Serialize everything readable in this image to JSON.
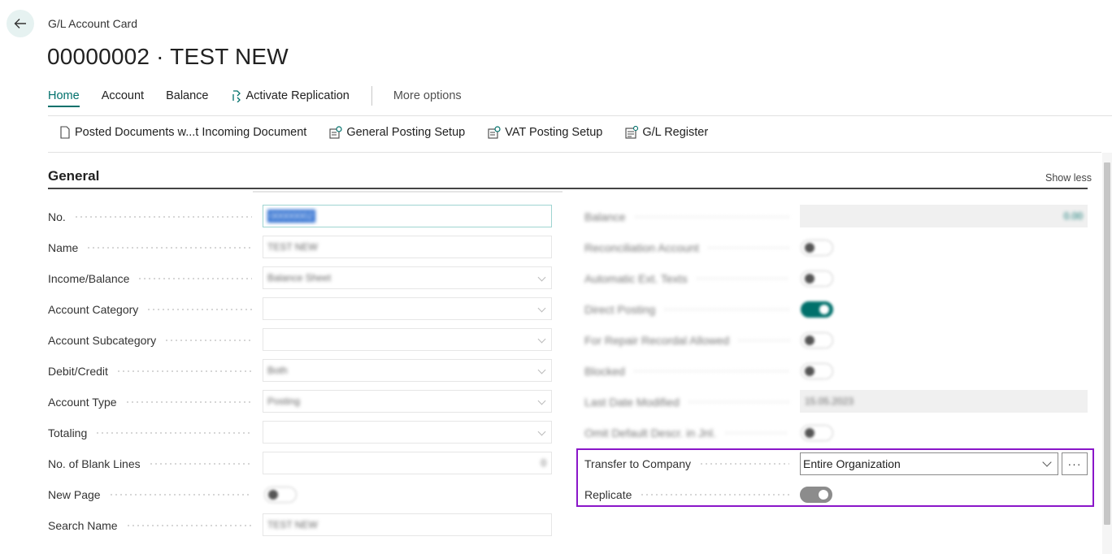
{
  "header": {
    "caption": "G/L Account Card",
    "title": "00000002 · TEST NEW"
  },
  "tabs": [
    {
      "label": "Home",
      "active": true
    },
    {
      "label": "Account"
    },
    {
      "label": "Balance"
    },
    {
      "label": "Activate Replication",
      "icon": "replication-icon"
    },
    {
      "label": "More options"
    }
  ],
  "subactions": [
    {
      "label": "Posted Documents w...t Incoming Document",
      "icon": "document-icon"
    },
    {
      "label": "General Posting Setup",
      "icon": "setup-icon"
    },
    {
      "label": "VAT Posting Setup",
      "icon": "setup-icon"
    },
    {
      "label": "G/L Register",
      "icon": "register-icon"
    }
  ],
  "section": {
    "title": "General",
    "show_less": "Show less"
  },
  "left_fields": [
    {
      "label": "No.",
      "value": "00000002",
      "kind": "text"
    },
    {
      "label": "Name",
      "value": "TEST NEW",
      "kind": "text"
    },
    {
      "label": "Income/Balance",
      "value": "Balance Sheet",
      "kind": "select"
    },
    {
      "label": "Account Category",
      "value": "",
      "kind": "select"
    },
    {
      "label": "Account Subcategory",
      "value": "",
      "kind": "select"
    },
    {
      "label": "Debit/Credit",
      "value": "Both",
      "kind": "select"
    },
    {
      "label": "Account Type",
      "value": "Posting",
      "kind": "select"
    },
    {
      "label": "Totaling",
      "value": "",
      "kind": "select"
    },
    {
      "label": "No. of Blank Lines",
      "value": "0",
      "kind": "number"
    },
    {
      "label": "New Page",
      "value": "off",
      "kind": "toggle"
    },
    {
      "label": "Search Name",
      "value": "TEST NEW",
      "kind": "text"
    }
  ],
  "right_fields": [
    {
      "label": "Balance",
      "value": "0.00",
      "kind": "readonly"
    },
    {
      "label": "Reconciliation Account",
      "value": "off",
      "kind": "toggle"
    },
    {
      "label": "Automatic Ext. Texts",
      "value": "off",
      "kind": "toggle"
    },
    {
      "label": "Direct Posting",
      "value": "on",
      "kind": "toggle"
    },
    {
      "label": "For Repair Recordal Allowed",
      "value": "off",
      "kind": "toggle"
    },
    {
      "label": "Blocked",
      "value": "off",
      "kind": "toggle"
    },
    {
      "label": "Last Date Modified",
      "value": "15.05.2023",
      "kind": "readonly"
    },
    {
      "label": "Omit Default Descr. in Jnl.",
      "value": "off",
      "kind": "toggle"
    }
  ],
  "replication": {
    "transfer_label": "Transfer to Company",
    "transfer_value": "Entire Organization",
    "ellipsis": "···",
    "replicate_label": "Replicate",
    "replicate_value": "on"
  },
  "colors": {
    "accent": "#00706b",
    "highlight": "#8a16c9"
  }
}
